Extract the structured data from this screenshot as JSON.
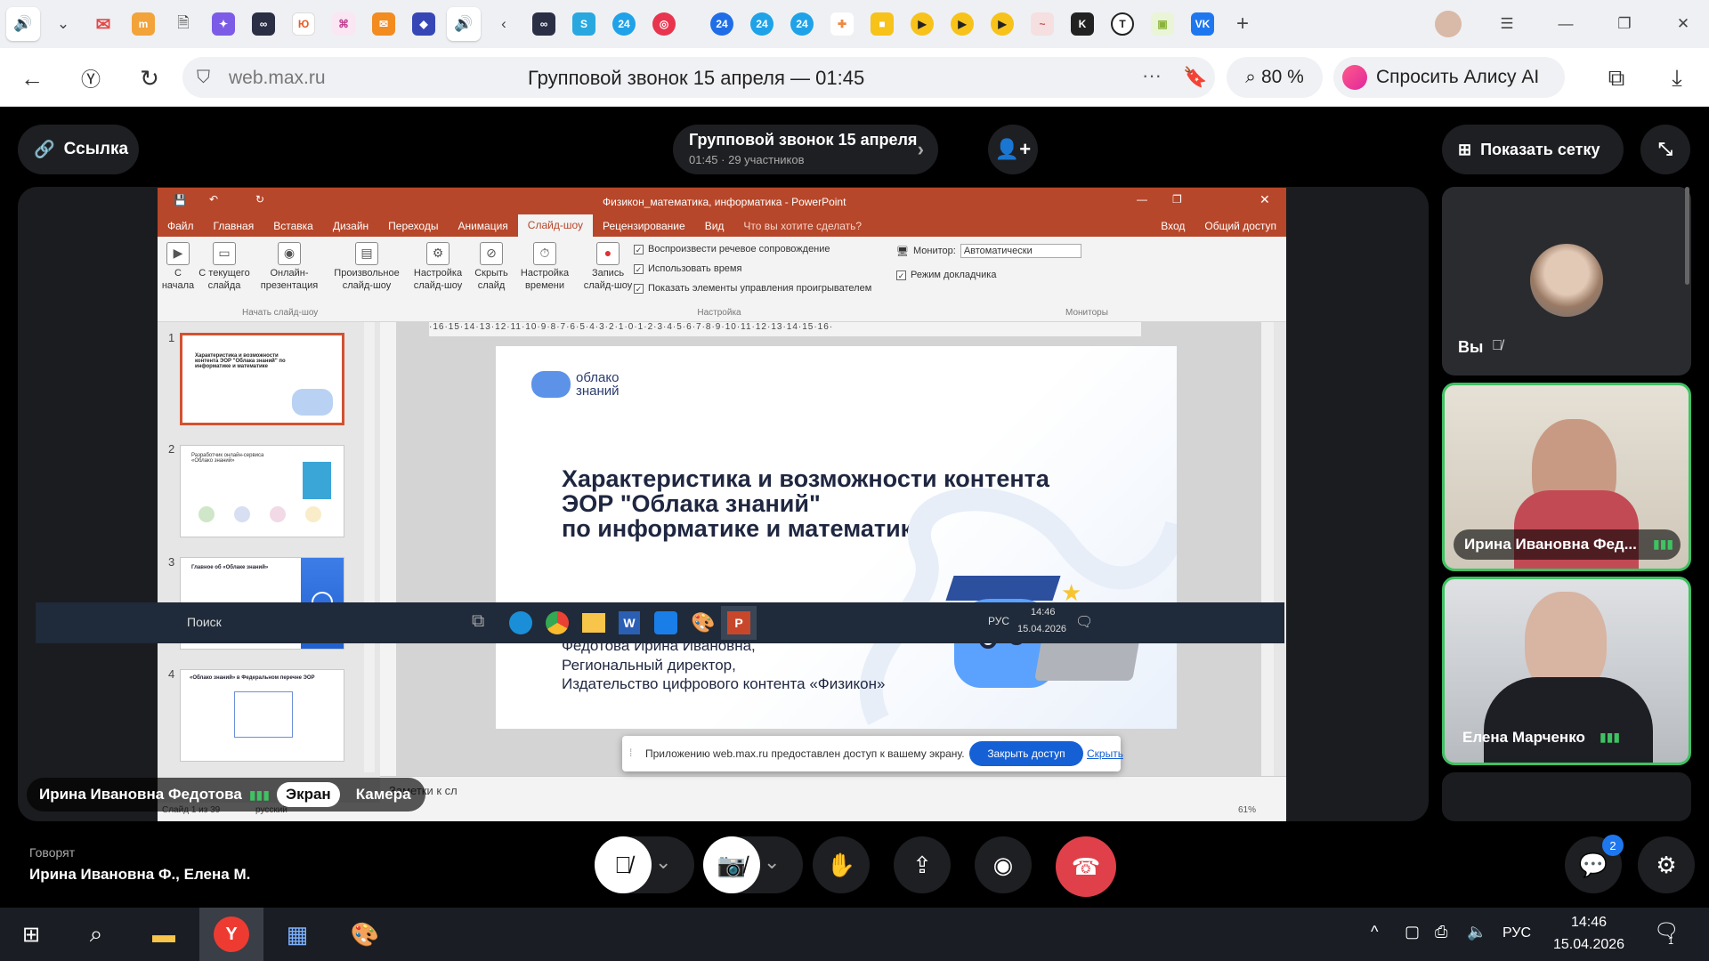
{
  "browser": {
    "url": "web.max.ru",
    "page_title": "Групповой звонок 15 апреля — 01:45",
    "zoom": "80 %",
    "alice_button": "Спросить Алису AI",
    "tab_badges": [
      "24",
      "24",
      "24",
      "24"
    ]
  },
  "call": {
    "link_button": "Ссылка",
    "title": "Групповой звонок 15 апреля",
    "subtitle": "01:45 · 29 участников",
    "grid_button": "Показать сетку",
    "speaking_label": "Говорят",
    "speaking_names": "Ирина Ивановна Ф., Елена М.",
    "presenter_name": "Ирина Ивановна Федотова",
    "source_tabs": [
      "Экран",
      "Камера"
    ],
    "chat_badge": "2",
    "participants": [
      {
        "name": "Вы",
        "muted": true
      },
      {
        "name": "Ирина Ивановна Фед...",
        "speaking": true
      },
      {
        "name": "Елена Марченко",
        "speaking": true
      }
    ]
  },
  "ppt": {
    "window_title": "Физикон_математика, информатика - PowerPoint",
    "menu": [
      "Файл",
      "Главная",
      "Вставка",
      "Дизайн",
      "Переходы",
      "Анимация",
      "Слайд-шоу",
      "Рецензирование",
      "Вид"
    ],
    "tell_me": "Что вы хотите сделать?",
    "signin": "Вход",
    "share": "Общий доступ",
    "ribbon_buttons": [
      "С начала",
      "С текущего слайда",
      "Онлайн-презентация",
      "Произвольное слайд-шоу",
      "Настройка слайд-шоу",
      "Скрыть слайд",
      "Настройка времени",
      "Запись слайд-шоу"
    ],
    "group_start": "Начать слайд-шоу",
    "group_setup": "Настройка",
    "group_monitors": "Мониторы",
    "checks": [
      "Воспроизвести речевое сопровождение",
      "Использовать время",
      "Показать элементы управления проигрывателем"
    ],
    "monitor_label": "Монитор:",
    "monitor_value": "Автоматически",
    "presenter_view": "Режим докладчика",
    "ruler": "·16·15·14·13·12·11·10·9·8·7·6·5·4·3·2·1·0·1·2·3·4·5·6·7·8·9·10·11·12·13·14·15·16·",
    "notes": "Заметки к сл",
    "status_slide": "Слайд 1 из 39",
    "status_lang": "русский",
    "zoom": "61%",
    "thumb_numbers": [
      "1",
      "2",
      "3",
      "4"
    ],
    "thumb1_title": "Характеристика и возможности контента ЭОР \"Облака знаний\" по информатике и математике",
    "thumb2_title": "Разработчик онлайн-сервиса «Облако знаний»",
    "thumb3_title": "Главное об «Облаке знаний»",
    "thumb4_title": "«Облако знаний» в Федеральном перечне ЭОР"
  },
  "slide": {
    "logo": "облако знаний",
    "title_lines": [
      "Характеристика и возможности контента",
      "ЭОР \"Облака знаний\"",
      "по информатике и математике"
    ],
    "author_lines": [
      "Федотова Ирина Ивановна,",
      "Региональный директор,",
      "Издательство цифрового контента «Физикон»"
    ]
  },
  "share_notice": {
    "text": "Приложению web.max.ru предоставлен доступ к вашему экрану.",
    "close_access": "Закрыть доступ",
    "hide": "Скрыть"
  },
  "remote_taskbar": {
    "search": "Поиск",
    "time": "14:46",
    "date": "15.04.2026",
    "lang": "РУС"
  },
  "os_taskbar": {
    "time": "14:46",
    "date": "15.04.2026",
    "lang": "РУС",
    "notif": "1"
  },
  "colors": {
    "ppt_accent": "#b7472a",
    "speaking": "#3ec262",
    "hangup": "#e0404a",
    "share_button": "#1560d4"
  }
}
